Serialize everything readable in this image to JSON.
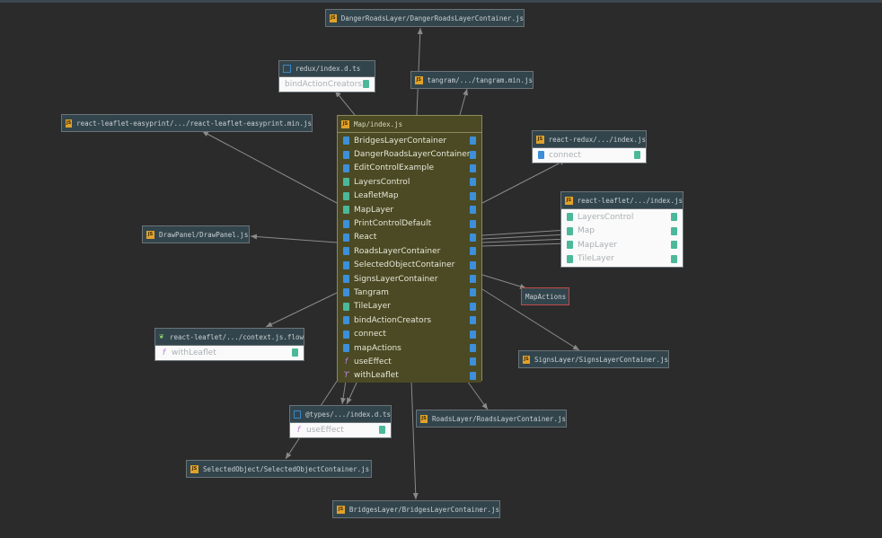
{
  "nodes": {
    "danger": {
      "title": "DangerRoadsLayer/DangerRoadsLayerContainer.js",
      "icon": "js-file-icon"
    },
    "redux": {
      "title": "redux/index.d.ts",
      "icon": "ts-file-icon",
      "members": [
        "bindActionCreators"
      ]
    },
    "tangram": {
      "title": "tangram/.../tangram.min.js",
      "icon": "js-file-icon"
    },
    "easyprint": {
      "title": "react-leaflet-easyprint/.../react-leaflet-easyprint.min.js",
      "icon": "js-file-icon"
    },
    "map": {
      "title": "Map/index.js",
      "icon": "js-file-icon",
      "members": [
        "BridgesLayerContainer",
        "DangerRoadsLayerContainer",
        "EditControlExample",
        "LayersControl",
        "LeafletMap",
        "MapLayer",
        "PrintControlDefault",
        "React",
        "RoadsLayerContainer",
        "SelectedObjectContainer",
        "SignsLayerContainer",
        "Tangram",
        "TileLayer",
        "bindActionCreators",
        "connect",
        "mapActions",
        "useEffect",
        "withLeaflet"
      ]
    },
    "reactredux": {
      "title": "react-redux/.../index.js",
      "icon": "js-file-icon",
      "members": [
        "connect"
      ]
    },
    "reactleaflet": {
      "title": "react-leaflet/.../index.js",
      "icon": "js-file-icon",
      "members": [
        "LayersControl",
        "Map",
        "MapLayer",
        "TileLayer"
      ]
    },
    "drawpanel": {
      "title": "DrawPanel/DrawPanel.js",
      "icon": "js-file-icon"
    },
    "mapactions": {
      "title": "MapActions"
    },
    "context": {
      "title": "react-leaflet/.../context.js.flow",
      "icon": "flow-file-icon",
      "members": [
        "withLeaflet"
      ]
    },
    "signs": {
      "title": "SignsLayer/SignsLayerContainer.js",
      "icon": "js-file-icon"
    },
    "types": {
      "title": "@types/.../index.d.ts",
      "icon": "ts-file-icon",
      "members": [
        "useEffect"
      ]
    },
    "roads": {
      "title": "RoadsLayer/RoadsLayerContainer.js",
      "icon": "js-file-icon"
    },
    "selected": {
      "title": "SelectedObject/SelectedObjectContainer.js",
      "icon": "js-file-icon"
    },
    "bridges": {
      "title": "BridgesLayer/BridgesLayerContainer.js",
      "icon": "js-file-icon"
    }
  },
  "colors": {
    "background": "#2b2b2b",
    "node_header": "#33454c",
    "focus_node": "#4b4a24",
    "edge": "#8a8a8a",
    "error_border": "#c24a4a"
  }
}
